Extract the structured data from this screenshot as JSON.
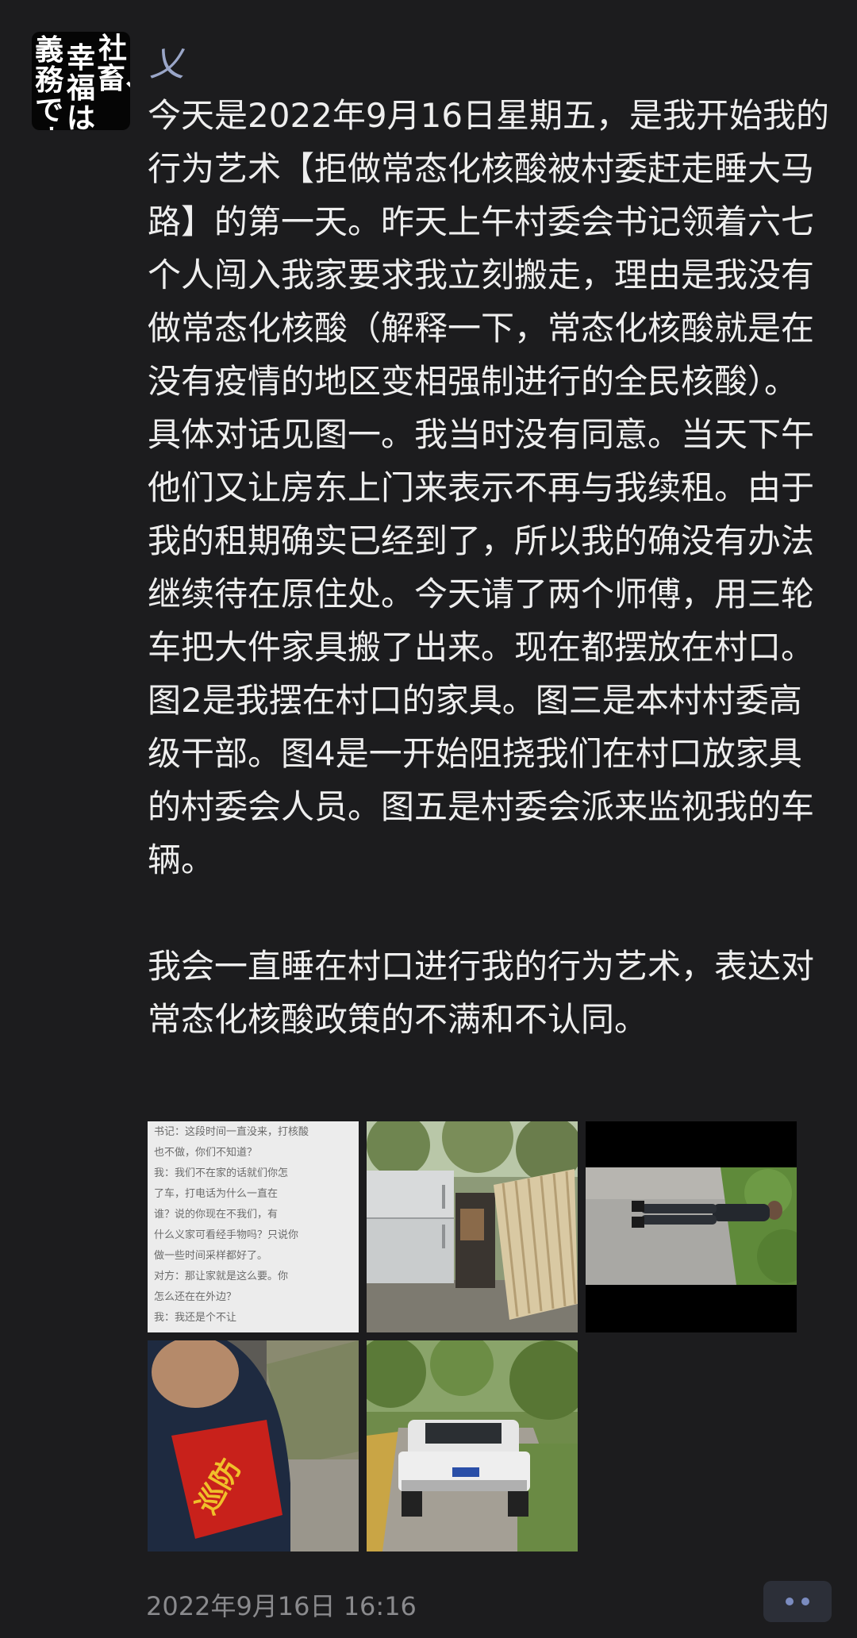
{
  "post": {
    "avatar_text": {
      "col1": "社\n畜、",
      "col2": "幸\n福\nは",
      "col3": "義\n務\nです"
    },
    "username": "乂",
    "paragraphs": [
      "今天是2022年9月16日星期五，是我开始我的行为艺术【拒做常态化核酸被村委赶走睡大马路】的第一天。昨天上午村委会书记领着六七个人闯入我家要求我立刻搬走，理由是我没有做常态化核酸（解释一下，常态化核酸就是在没有疫情的地区变相强制进行的全民核酸）。具体对话见图一。我当时没有同意。当天下午他们又让房东上门来表示不再与我续租。由于我的租期确实已经到了，所以我的确没有办法继续待在原住处。今天请了两个师傅，用三轮车把大件家具搬了出来。现在都摆放在村口。图2是我摆在村口的家具。图三是本村村委高级干部。图4是一开始阻挠我们在村口放家具的村委会人员。图五是村委会派来监视我的车辆。",
      "我会一直睡在村口进行我的行为艺术，表达对常态化核酸政策的不满和不认同。"
    ],
    "timestamp": "2022年9月16日 16:16"
  },
  "images": {
    "img1_chat_lines": [
      "书记：这段时间一直没来，打核酸",
      "也不做，你们不知道？",
      "我：我们不在家的话就们你怎",
      "了车，打电话为什么一直在",
      "谁？说的你现在不我们，有",
      "什么义家可看经手物吗？只说你",
      "做一些时间采样都好了。",
      "对方：那让家就是这么要。你",
      "怎么还在在外边？",
      "我：我还是个不让"
    ],
    "armband_text": "巡防"
  },
  "colors": {
    "background": "#1c1c1e",
    "text": "#eeeeee",
    "username": "#9aa6c8",
    "timestamp": "#8a8a8d",
    "more_button": "#2c2f38",
    "more_dots": "#7b8cc0"
  },
  "icons": {
    "more": "more-dots-icon"
  }
}
